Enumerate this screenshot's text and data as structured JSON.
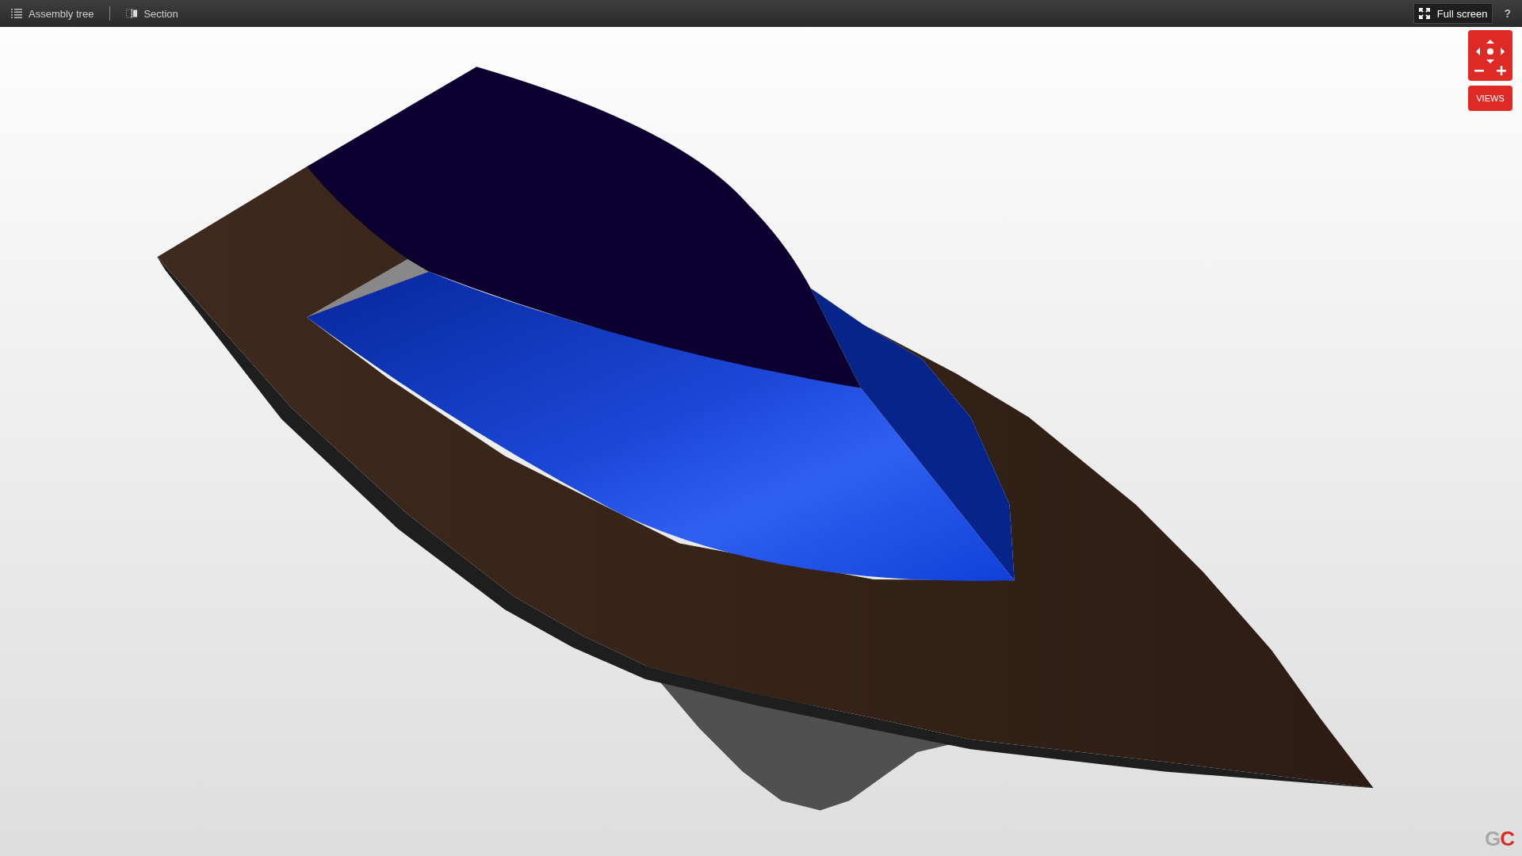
{
  "toolbar": {
    "left": [
      {
        "kind": "tree",
        "label": "Assembly tree"
      },
      {
        "kind": "section",
        "label": "Section"
      }
    ],
    "fullscreen": {
      "label": "Full screen"
    },
    "help": "?"
  },
  "views_button": {
    "label": "VIEWS"
  },
  "logo": {
    "first": "G",
    "second": "C"
  }
}
